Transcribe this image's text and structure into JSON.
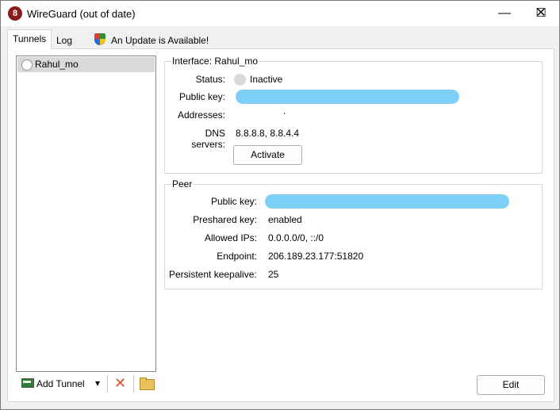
{
  "window": {
    "title": "WireGuard (out of date)",
    "app_icon_glyph": "8",
    "minimize_glyph": "—",
    "maximize_glyph": "☐",
    "close_glyph": "✕"
  },
  "tabs": [
    {
      "label": "Tunnels",
      "active": true
    },
    {
      "label": "Log",
      "active": false
    },
    {
      "label": "An Update is Available!",
      "active": false,
      "icon": "shield-icon"
    }
  ],
  "tunnel_list": {
    "items": [
      {
        "name": "Rahul_mo",
        "selected": true,
        "status_icon": "inactive-circle-icon"
      }
    ]
  },
  "interface": {
    "title": "Interface: Rahul_mo",
    "status_label": "Status:",
    "status_value": "Inactive",
    "public_key_label": "Public key:",
    "addresses_label": "Addresses:",
    "addresses_value": ".",
    "dns_label": "DNS servers:",
    "dns_value": "8.8.8.8, 8.8.4.4",
    "activate_button": "Activate"
  },
  "peer": {
    "title": "Peer",
    "public_key_label": "Public key:",
    "preshared_key_label": "Preshared key:",
    "preshared_key_value": "enabled",
    "allowed_ips_label": "Allowed IPs:",
    "allowed_ips_value": "0.0.0.0/0, ::/0",
    "endpoint_label": "Endpoint:",
    "endpoint_value": "206.189.23.177:51820",
    "keepalive_label": "Persistent keepalive:",
    "keepalive_value": "25"
  },
  "toolbar": {
    "add_tunnel_label": "Add Tunnel",
    "dropdown_glyph": "▾",
    "delete_glyph": "✕",
    "edit_label": "Edit"
  },
  "colors": {
    "redaction": "#7fd0f6",
    "delete_icon": "#d9532c",
    "selected_row": "#d9d9d9"
  }
}
